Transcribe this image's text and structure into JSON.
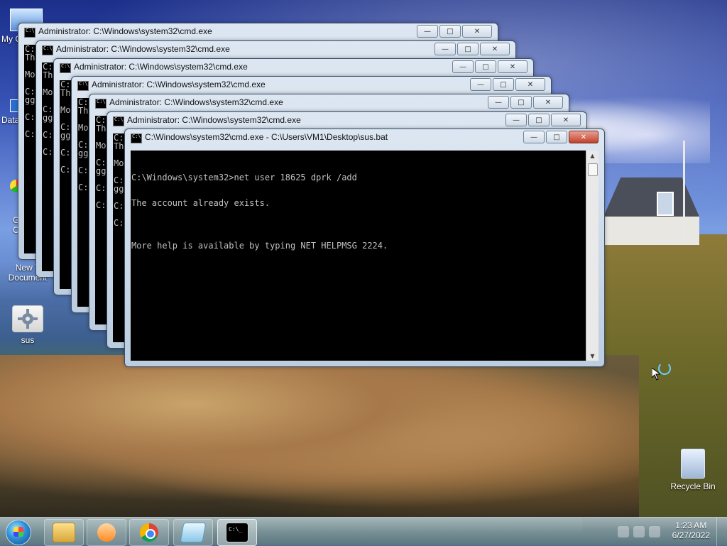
{
  "desktop": {
    "icons": [
      {
        "id": "my-computer",
        "label": "My C"
      },
      {
        "id": "data",
        "label": "Data"
      },
      {
        "id": "g",
        "label": "G\nC"
      },
      {
        "id": "new-text-document",
        "label": "New T\nDocument"
      },
      {
        "id": "sus",
        "label": "sus"
      },
      {
        "id": "recycle-bin",
        "label": "Recycle Bin"
      }
    ]
  },
  "windows": {
    "background": [
      {
        "title": "Administrator: C:\\Windows\\system32\\cmd.exe",
        "peek": "C:\nTh\n\nMo\n\nC:\ngg\n\nC:\n\nC:\n\n"
      },
      {
        "title": "Administrator: C:\\Windows\\system32\\cmd.exe",
        "peek": "C:\nTh\n\nMo\n\nC:\ngg\n\nC:\n\nC:\n\n"
      },
      {
        "title": "Administrator: C:\\Windows\\system32\\cmd.exe",
        "peek": "C:\nTh\n\nMo\n\nC:\ngg\n\nC:\n\nC:\n\n"
      },
      {
        "title": "Administrator: C:\\Windows\\system32\\cmd.exe",
        "peek": "C:\nTh\n\nMo\n\nC:\ngg\n\nC:\n\nC:\n\n"
      },
      {
        "title": "Administrator: C:\\Windows\\system32\\cmd.exe",
        "peek": "C:\nTh\n\nMo\n\nC:\ngg\n\nC:\n\nC:\n\n"
      },
      {
        "title": "Administrator: C:\\Windows\\system32\\cmd.exe",
        "peek": "C:\nTh\n\nMo\n\nC:\ngg\n\nC:\n\nC:\n\n"
      }
    ],
    "active": {
      "title": "C:\\Windows\\system32\\cmd.exe - C:\\Users\\VM1\\Desktop\\sus.bat",
      "lines": [
        "C:\\Windows\\system32>net user 18625 dprk /add",
        "The account already exists.",
        "",
        "More help is available by typing NET HELPMSG 2224."
      ]
    },
    "controls": {
      "minimize": "—",
      "maximize": "□",
      "close": "✕"
    }
  },
  "taskbar": {
    "items": [
      {
        "id": "explorer",
        "icon": "folder-icon"
      },
      {
        "id": "media-player",
        "icon": "media-player-icon"
      },
      {
        "id": "chrome",
        "icon": "chrome-icon"
      },
      {
        "id": "notepad",
        "icon": "notepad-icon"
      },
      {
        "id": "cmd",
        "icon": "cmd-icon"
      }
    ],
    "clock": {
      "time": "1:23 AM",
      "date": "6/27/2022"
    }
  }
}
